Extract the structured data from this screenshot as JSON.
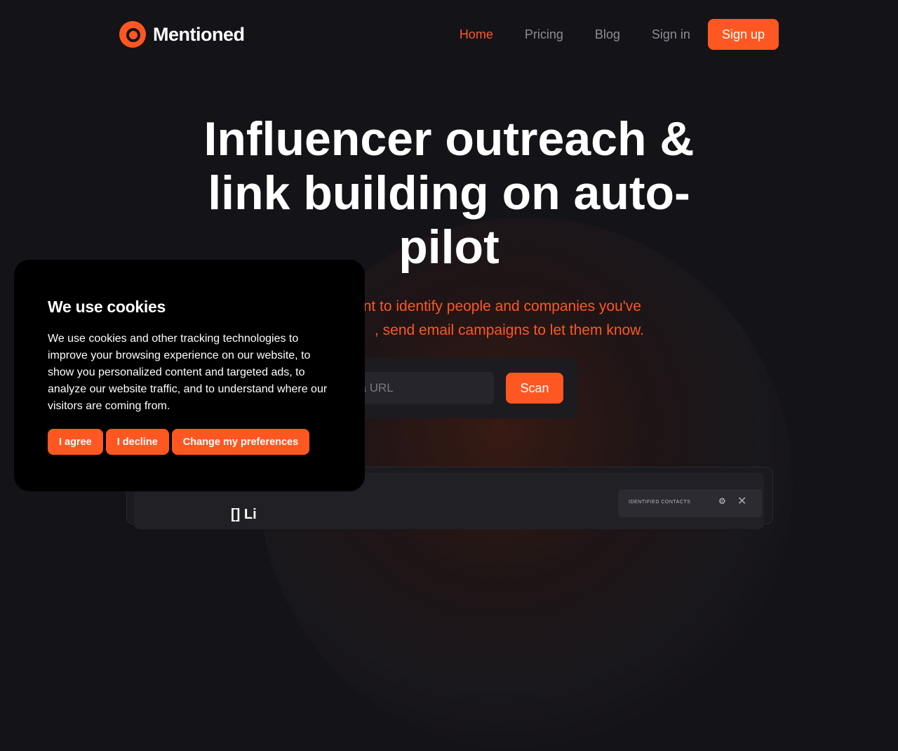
{
  "brand": {
    "name": "Mentioned",
    "accent": "#ff5722"
  },
  "nav": {
    "items": [
      {
        "label": "Home",
        "active": true
      },
      {
        "label": "Pricing",
        "active": false
      },
      {
        "label": "Blog",
        "active": false
      },
      {
        "label": "Sign in",
        "active": false
      }
    ],
    "signup_label": "Sign up"
  },
  "hero": {
    "title_lines": [
      "Influencer outreach &",
      "link building on auto-",
      "pilot"
    ],
    "subtitle_line1": "ent to identify people and companies you've",
    "subtitle_line2": ", send email campaigns to let them know.",
    "url_placeholder": "ter a URL",
    "scan_label": "Scan"
  },
  "preview": {
    "heading": "[] Li",
    "contacts_title": "IDENTIFIED CONTACTS",
    "gear_icon": "gear-icon",
    "close_icon": "close-icon"
  },
  "cookie": {
    "title": "We use cookies",
    "body": "We use cookies and other tracking technologies to improve your browsing experience on our website, to show you personalized content and targeted ads, to analyze our website traffic, and to understand where our visitors are coming from.",
    "agree_label": "I agree",
    "decline_label": "I decline",
    "prefs_label": "Change my preferences"
  }
}
